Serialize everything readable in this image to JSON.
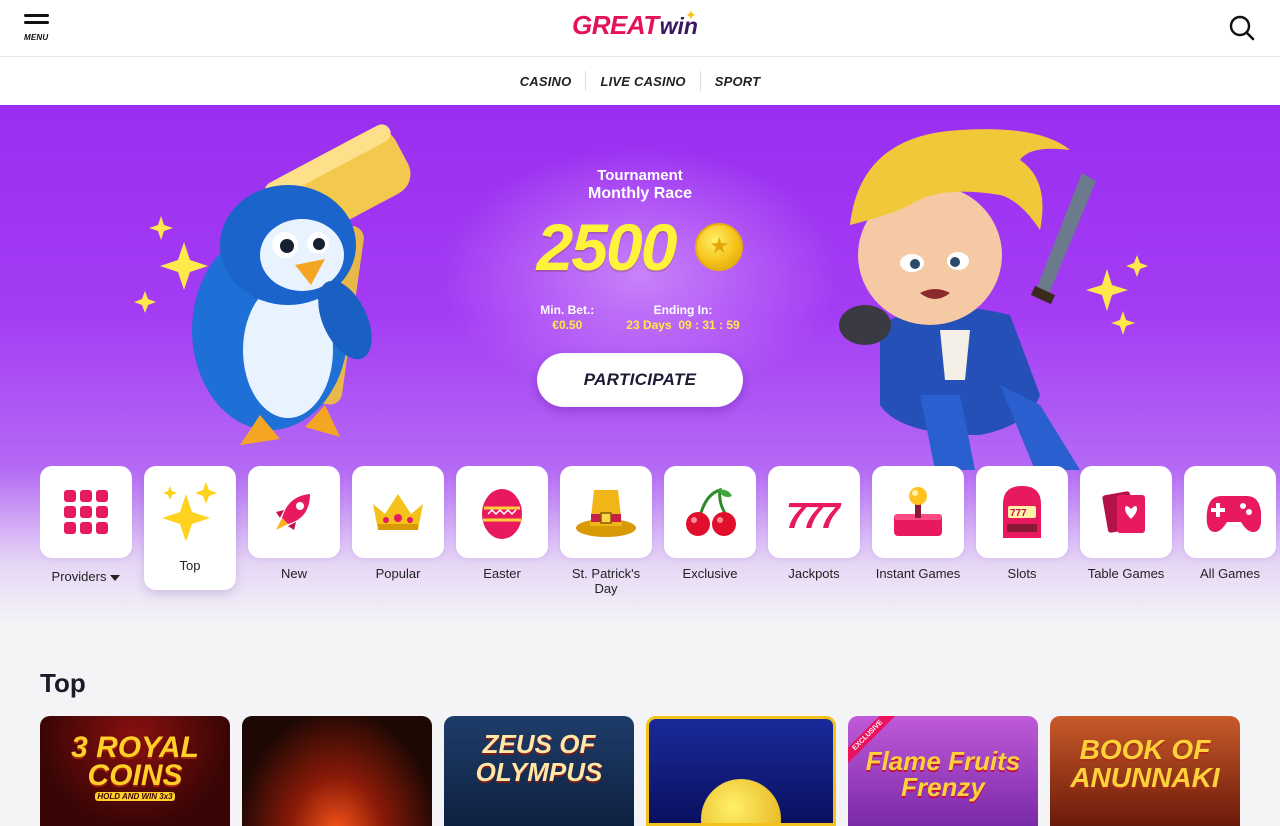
{
  "header": {
    "menu_label": "MENU",
    "logo_great": "GREAT",
    "logo_win": "win",
    "search_icon": "search-icon"
  },
  "subnav": {
    "items": [
      {
        "label": "CASINO"
      },
      {
        "label": "LIVE CASINO"
      },
      {
        "label": "SPORT"
      }
    ]
  },
  "promo": {
    "line1": "Tournament",
    "line2": "Monthly Race",
    "amount": "2500",
    "min_bet_label": "Min. Bet.:",
    "min_bet_value": "€0.50",
    "ending_label": "Ending In:",
    "ending_value": "23 Days  09 : 31 : 59",
    "button": "PARTICIPATE"
  },
  "categories": [
    {
      "label": "Providers",
      "icon": "grid-icon"
    },
    {
      "label": "Top",
      "icon": "sparkle-icon"
    },
    {
      "label": "New",
      "icon": "rocket-icon"
    },
    {
      "label": "Popular",
      "icon": "crown-icon"
    },
    {
      "label": "Easter",
      "icon": "egg-icon"
    },
    {
      "label": "St. Patrick's Day",
      "icon": "leprechaun-hat-icon"
    },
    {
      "label": "Exclusive",
      "icon": "cherries-icon"
    },
    {
      "label": "Jackpots",
      "icon": "777-icon"
    },
    {
      "label": "Instant Games",
      "icon": "joystick-icon"
    },
    {
      "label": "Slots",
      "icon": "slot-machine-icon"
    },
    {
      "label": "Table Games",
      "icon": "cards-icon"
    },
    {
      "label": "All Games",
      "icon": "gamepad-icon"
    }
  ],
  "section": {
    "title": "Top"
  },
  "games": [
    {
      "title": "3 ROYAL COINS",
      "subtitle": "HOLD AND WIN 3x3"
    },
    {
      "title": ""
    },
    {
      "title": "ZEUS OF OLYMPUS"
    },
    {
      "title": ""
    },
    {
      "title": "Flame Fruits Frenzy",
      "badge": "EXCLUSIVE"
    },
    {
      "title": "BOOK OF ANUNNAKI"
    }
  ],
  "colors": {
    "brand_pink": "#e4125a",
    "brand_purple": "#3b1763",
    "hero_purple": "#9a2ef0",
    "prize_yellow": "#fff23a"
  }
}
